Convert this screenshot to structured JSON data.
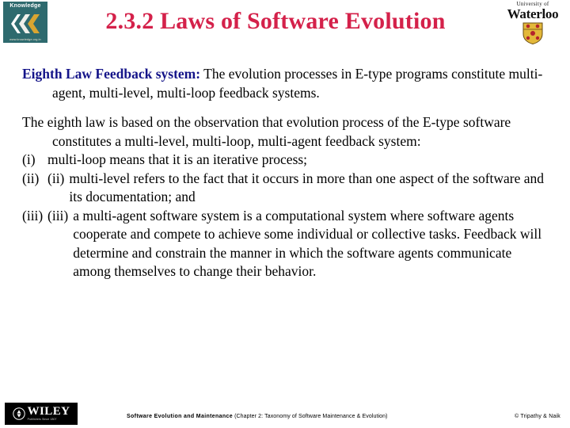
{
  "header": {
    "title": "2.3.2 Laws of Software Evolution",
    "title_color": "#d4214a",
    "left_logo": {
      "name": "Knowledge",
      "url": "www.knowledge.org.in",
      "bg_color": "#2e6a6e"
    },
    "right_logo": {
      "line1": "University of",
      "line2": "Waterloo"
    }
  },
  "main": {
    "law": {
      "title": "Eighth Law Feedback system:",
      "title_color": "#141489",
      "text": " The evolution processes in E-type programs constitute multi-agent, multi-level, multi-loop feedback systems."
    },
    "explanation": "The eighth law is based on the observation that evolution process of the E-type software constitutes a multi-level, multi-loop, multi-agent feedback system:",
    "items": [
      {
        "marker": "(i)",
        "marker_dup": "",
        "text": "multi-loop means that it is an iterative process;"
      },
      {
        "marker": "(ii)",
        "marker_dup": "(ii)",
        "text": "multi-level refers to the fact that it occurs in more than one aspect of the software and its documentation; and"
      },
      {
        "marker": "(iii)",
        "marker_dup": "(iii)",
        "text": "a multi-agent software system is a computational system where software agents cooperate and compete to achieve some individual or collective tasks. Feedback will determine and constrain the manner in which the software agents communicate among themselves to change their behavior."
      }
    ]
  },
  "footer": {
    "publisher": "WILEY",
    "publisher_tagline": "Publishers Since 1807",
    "center_bold": "Software Evolution and Maintenance",
    "center_rest": " (Chapter 2: Taxonomy of Software Maintenance & Evolution)",
    "copyright": "© Tripathy & Naik"
  }
}
